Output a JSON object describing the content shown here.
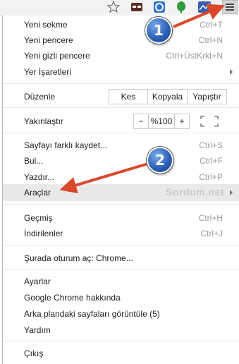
{
  "toolbar": {
    "icons": [
      "star-icon",
      "mask-extension-icon",
      "refresh-extension-icon",
      "green-leaf-extension-icon",
      "blue-extension-icon",
      "hamburger-menu-icon"
    ]
  },
  "menu": {
    "new_tab": {
      "label": "Yeni sekme",
      "shortcut": "Ctrl+T"
    },
    "new_window": {
      "label": "Yeni pencere",
      "shortcut": "Ctrl+N"
    },
    "incognito": {
      "label": "Yeni gizli pencere",
      "shortcut": "Ctrl+ÜstKrkt+N"
    },
    "bookmarks": {
      "label": "Yer İşaretleri"
    },
    "edit": {
      "label": "Düzenle",
      "cut": "Kes",
      "copy": "Kopyala",
      "paste": "Yapıştır"
    },
    "zoom": {
      "label": "Yakınlaştır",
      "minus": "−",
      "value": "%100",
      "plus": "+"
    },
    "save_page": {
      "label": "Sayfayı farklı kaydet...",
      "shortcut": "Ctrl+S"
    },
    "find": {
      "label": "Bul...",
      "shortcut": "Ctrl+F"
    },
    "print": {
      "label": "Yazdır...",
      "shortcut": "Ctrl+P"
    },
    "tools": {
      "label": "Araçlar"
    },
    "history": {
      "label": "Geçmiş",
      "shortcut": "Ctrl+H"
    },
    "downloads": {
      "label": "İndirilenler",
      "shortcut": "Ctrl+J"
    },
    "sign_in": {
      "label": "Şurada oturum aç: Chrome..."
    },
    "settings": {
      "label": "Ayarlar"
    },
    "about": {
      "label": "Google Chrome hakkında"
    },
    "background_pages": {
      "label": "Arka plandaki sayfaları görüntüle (5)"
    },
    "help": {
      "label": "Yardım"
    },
    "exit": {
      "label": "Çıkış"
    }
  },
  "watermark": "Sordum.net",
  "annotations": {
    "badge1": "1",
    "badge2": "2",
    "arrow_color": "#d9482b",
    "badge_color": "#2d63b8"
  }
}
